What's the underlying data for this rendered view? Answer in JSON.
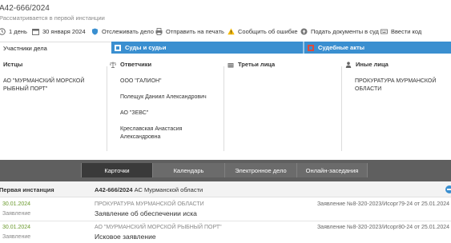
{
  "case": {
    "number": "А42-666/2024",
    "status": "Рассматривается в первой инстанции"
  },
  "toolbar": {
    "items": [
      {
        "label": "1 день",
        "icon": "clock-icon"
      },
      {
        "label": "30 января 2024",
        "icon": "calendar-icon"
      },
      {
        "label": "Отслеживать дело",
        "icon": "shield-icon"
      },
      {
        "label": "Отправить на печать",
        "icon": "printer-icon"
      },
      {
        "label": "Сообщить об ошибке",
        "icon": "warning-icon"
      },
      {
        "label": "Подать документы в суд",
        "icon": "upload-icon"
      },
      {
        "label": "Ввести код",
        "icon": "keyboard-icon"
      }
    ]
  },
  "tabs": {
    "participants": "Участники дела",
    "courts": "Суды и судьи",
    "acts": "Судебные акты"
  },
  "parties": {
    "plaintiffs": {
      "title": "Истцы",
      "items": [
        "АО \"МУРМАНСКИЙ МОРСКОЙ РЫБНЫЙ ПОРТ\""
      ]
    },
    "defendants": {
      "title": "Ответчики",
      "items": [
        "ООО \"ГАЛИОН\"",
        "Полещук Даниил Александрович",
        "АО \"ЗЕВС\"",
        "Креславская Анастасия Александровна"
      ]
    },
    "third": {
      "title": "Третьи лица",
      "items": []
    },
    "other": {
      "title": "Иные лица",
      "items": [
        "ПРОКУРАТУРА МУРМАНСКОЙ ОБЛАСТИ"
      ]
    }
  },
  "bottom_nav": {
    "cards": "Карточки",
    "calendar": "Календарь",
    "electronic": "Электронное дело",
    "online": "Онлайн-заседания"
  },
  "instance": {
    "label": "Первая инстанция",
    "case_number": "А42-666/2024",
    "court": "АС Мурманской области"
  },
  "entries": [
    {
      "date": "30.01.2024",
      "kind": "Заявление",
      "from": "ПРОКУРАТУРА МУРМАНСКОЙ ОБЛАСТИ",
      "title": "Заявление об обеспечении иска",
      "ref": "Заявление №8-320-2023/Исорг79-24 от 25.01.2024"
    },
    {
      "date": "30.01.2024",
      "kind": "Заявление",
      "from": "АО \"МУРМАНСКИЙ МОРСКОЙ РЫБНЫЙ ПОРТ\"",
      "title": "Исковое заявление",
      "ref": "Заявление №8-320-2023/Исорг80-24 от 25.01.2024"
    }
  ],
  "colors": {
    "accent": "#3a8fd0",
    "date_green": "#6b9a2e",
    "nav_dark": "#5f5f5f"
  }
}
